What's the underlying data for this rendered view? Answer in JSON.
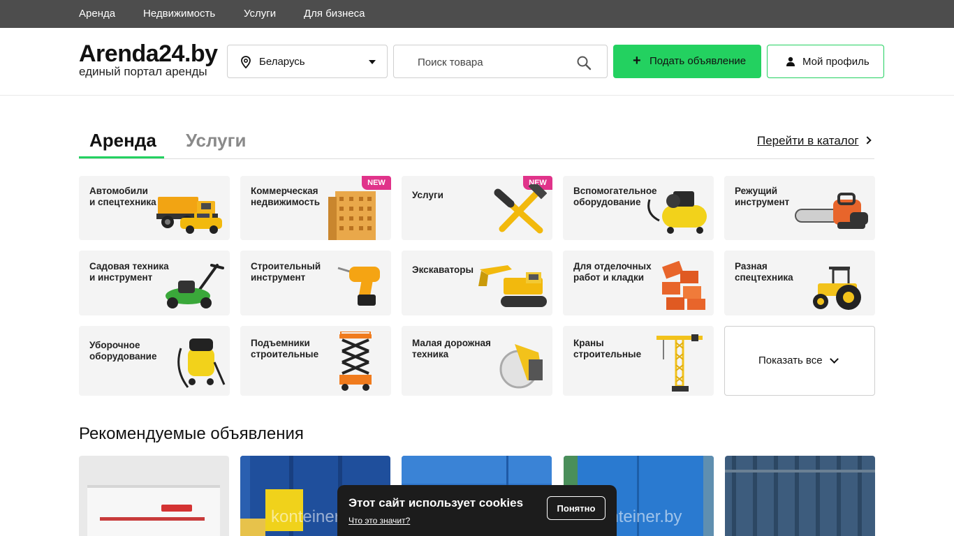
{
  "topnav": {
    "items": [
      {
        "label": "Аренда"
      },
      {
        "label": "Недвижимость"
      },
      {
        "label": "Услуги"
      },
      {
        "label": "Для бизнеса"
      }
    ]
  },
  "header": {
    "logo_name": "Arenda24.by",
    "logo_tagline": "единый портал аренды",
    "region_label": "Беларусь",
    "search_placeholder": "Поиск товара",
    "post_button": "Подать объявление",
    "profile_button": "Мой профиль"
  },
  "tabs": {
    "active": "Аренда",
    "inactive": "Услуги",
    "catalog_link": "Перейти в каталог"
  },
  "categories": [
    {
      "title": "Автомобили\nи спецтехника",
      "icon": "dump-truck-icon"
    },
    {
      "title": "Коммерческая\nнедвижимость",
      "icon": "building-icon",
      "badge": "NEW"
    },
    {
      "title": "Услуги",
      "icon": "hammer-wrench-icon",
      "badge": "NEW"
    },
    {
      "title": "Вспомогательное\nоборудование",
      "icon": "compressor-icon"
    },
    {
      "title": "Режущий\nинструмент",
      "icon": "chainsaw-icon"
    },
    {
      "title": "Садовая техника\nи инструмент",
      "icon": "lawn-mower-icon"
    },
    {
      "title": "Строительный\nинструмент",
      "icon": "drill-icon"
    },
    {
      "title": "Экскаваторы",
      "icon": "excavator-icon"
    },
    {
      "title": "Для отделочных\nработ и кладки",
      "icon": "bricks-icon"
    },
    {
      "title": "Разная\nспецтехника",
      "icon": "tractor-icon"
    },
    {
      "title": "Уборочное\nоборудование",
      "icon": "vacuum-icon"
    },
    {
      "title": "Подъемники\nстроительные",
      "icon": "scissor-lift-icon"
    },
    {
      "title": "Малая дорожная\nтехника",
      "icon": "road-saw-icon"
    },
    {
      "title": "Краны\nстроительные",
      "icon": "crane-icon"
    }
  ],
  "show_all": "Показать все",
  "recommended": {
    "title": "Рекомендуемые объявления",
    "watermark": "konteiner.by"
  },
  "cookie": {
    "text": "Этот сайт использует cookies",
    "link": "Что это значит?",
    "button": "Понятно"
  },
  "colors": {
    "accent": "#23d160",
    "badge": "#e0338a",
    "topbar": "#4d4d4d"
  }
}
